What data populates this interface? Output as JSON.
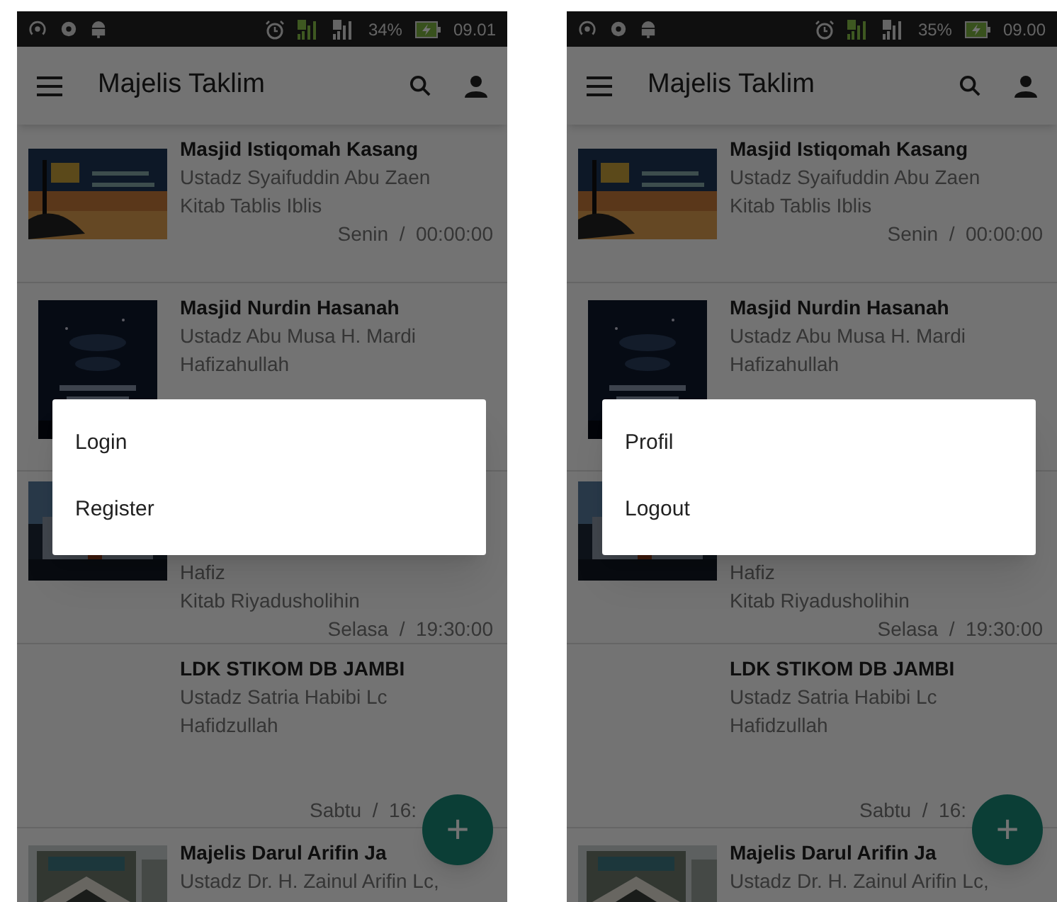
{
  "screens": [
    {
      "status_bar": {
        "battery": "34%",
        "time": "09.01"
      },
      "app_bar": {
        "title": "Majelis Taklim"
      },
      "items": [
        {
          "kind": "picture",
          "title": "Masjid Istiqomah Kasang",
          "lines": [
            "Ustadz Syaifuddin Abu Zaen",
            "Kitab Tablis Iblis"
          ],
          "schedule": "Senin  /  00:00:00"
        },
        {
          "kind": "picture",
          "title": "Masjid Nurdin Hasanah",
          "lines": [
            "Ustadz Abu Musa H. Mardi",
            "Hafizahullah"
          ]
        },
        {
          "kind": "picture",
          "lines": [
            "Hafiz",
            "Kitab Riyadusholihin"
          ],
          "schedule": "Selasa  /  19:30:00"
        },
        {
          "kind": "text",
          "title": "LDK STIKOM DB JAMBI",
          "lines": [
            "Ustadz Satria Habibi Lc",
            "Hafidzullah"
          ],
          "schedule": "Sabtu  /  16:"
        },
        {
          "kind": "picture",
          "title": "Majelis Darul Arifin Ja",
          "lines": [
            "Ustadz Dr. H. Zainul Arifin Lc,"
          ]
        }
      ],
      "menu": [
        "Login",
        "Register"
      ],
      "fab": "+"
    },
    {
      "status_bar": {
        "battery": "35%",
        "time": "09.00"
      },
      "app_bar": {
        "title": "Majelis Taklim"
      },
      "items": [
        {
          "kind": "picture",
          "title": "Masjid Istiqomah Kasang",
          "lines": [
            "Ustadz Syaifuddin Abu Zaen",
            "Kitab Tablis Iblis"
          ],
          "schedule": "Senin  /  00:00:00"
        },
        {
          "kind": "picture",
          "title": "Masjid Nurdin Hasanah",
          "lines": [
            "Ustadz Abu Musa H. Mardi",
            "Hafizahullah"
          ]
        },
        {
          "kind": "picture",
          "lines": [
            "Hafiz",
            "Kitab Riyadusholihin"
          ],
          "schedule": "Selasa  /  19:30:00"
        },
        {
          "kind": "text",
          "title": "LDK STIKOM DB JAMBI",
          "lines": [
            "Ustadz Satria Habibi Lc",
            "Hafidzullah"
          ],
          "schedule": "Sabtu  /  16:"
        },
        {
          "kind": "picture",
          "title": "Majelis Darul Arifin Ja",
          "lines": [
            "Ustadz Dr. H. Zainul Arifin Lc,"
          ]
        }
      ],
      "menu": [
        "Profil",
        "Logout"
      ],
      "fab": "+"
    }
  ]
}
